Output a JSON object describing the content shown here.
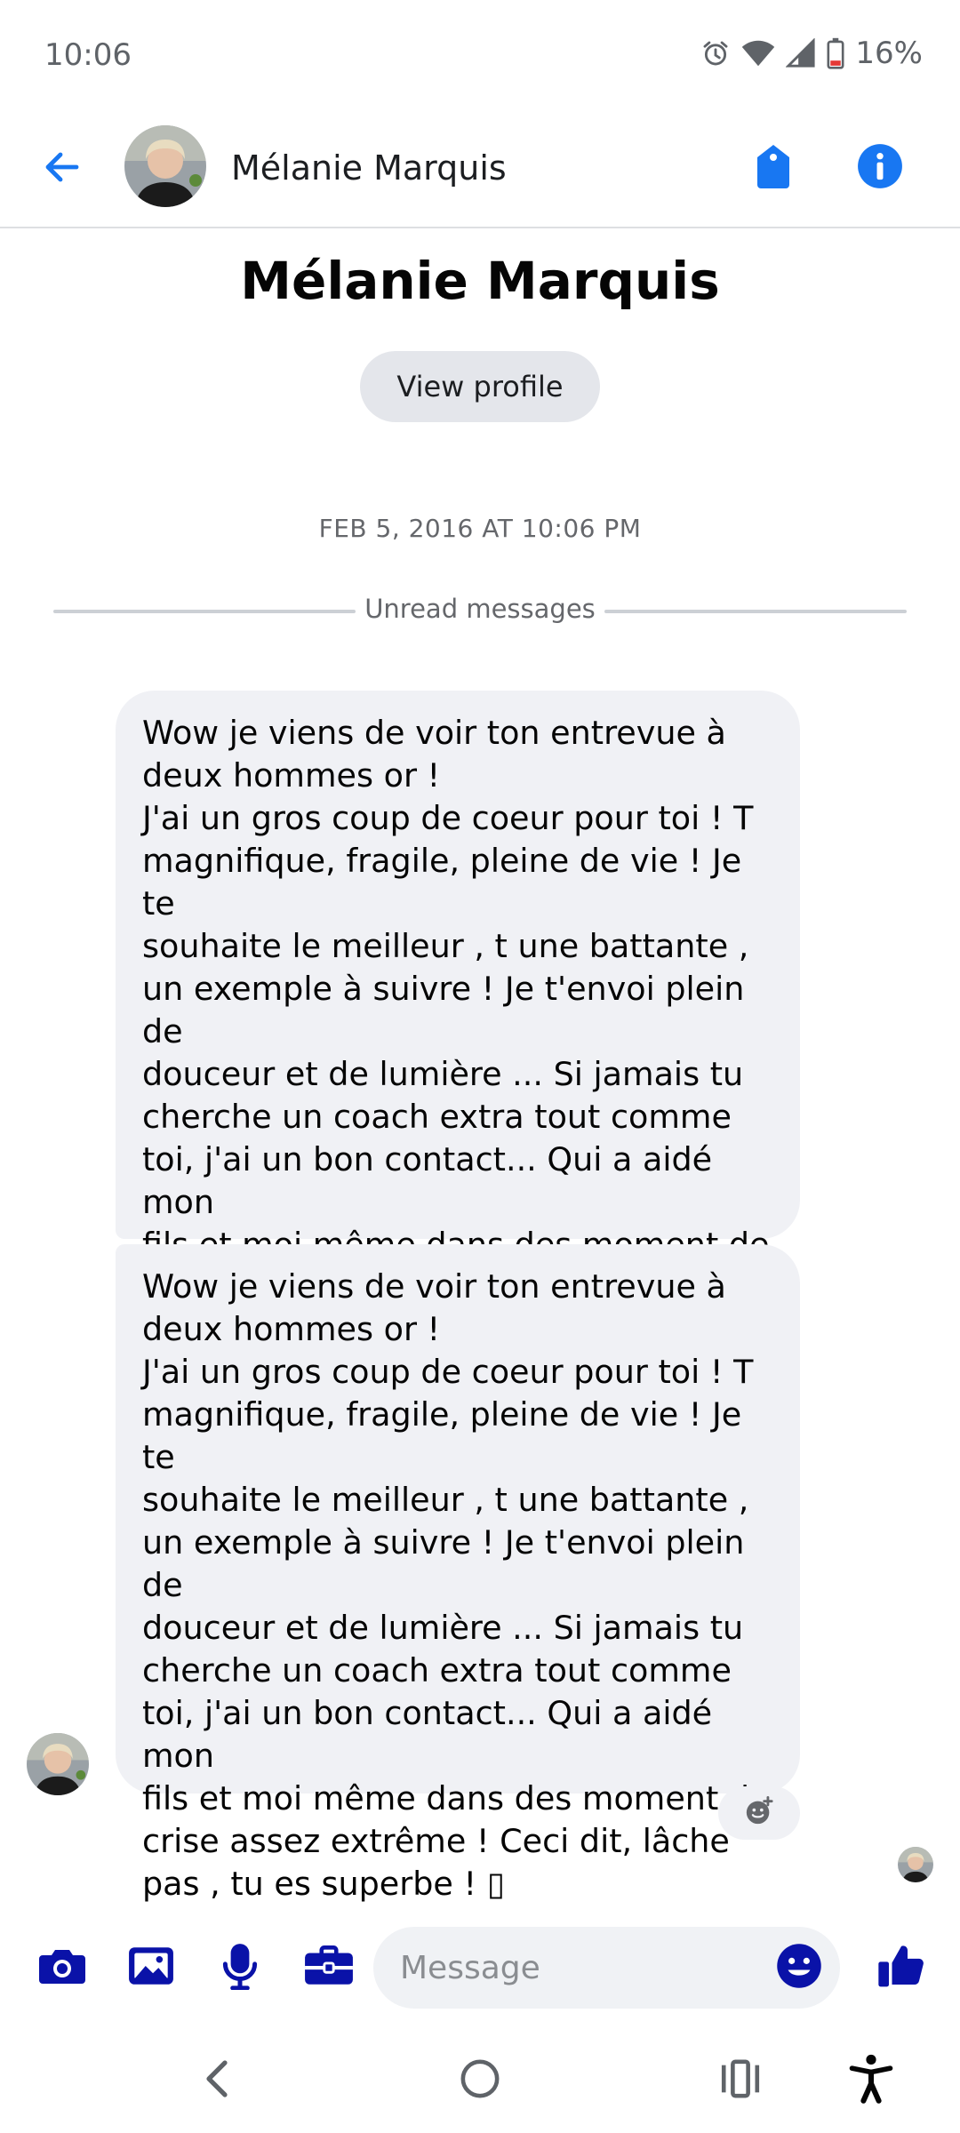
{
  "status_bar": {
    "time": "10:06",
    "battery": "16%"
  },
  "header": {
    "name": "Mélanie Marquis",
    "back_icon": "arrow-left-icon",
    "tag_icon": "tag-icon",
    "info_icon": "info-icon"
  },
  "profile": {
    "name": "Mélanie Marquis",
    "view_profile_label": "View profile"
  },
  "conversation": {
    "timestamp": "FEB 5, 2016 AT 10:06 PM",
    "unread_label": "Unread messages",
    "messages": [
      {
        "text": "Wow je viens de voir ton entrevue à\ndeux hommes or !\nJ'ai un gros coup de coeur pour toi ! T\nmagnifique, fragile, pleine de vie ! Je te\nsouhaite le meilleur , t une battante ,\nun exemple à suivre ! Je t'envoi plein de\ndouceur et de lumière ... Si jamais tu\ncherche un coach extra tout comme\ntoi, j'ai un bon contact... Qui a aidé mon\nfils et moi même dans des moment de\ncrise assez extrême ! Ceci dit, lâche\npas , tu es superbe ! ▯"
      },
      {
        "text": "Wow je viens de voir ton entrevue à\ndeux hommes or !\nJ'ai un gros coup de coeur pour toi ! T\nmagnifique, fragile, pleine de vie ! Je te\nsouhaite le meilleur , t une battante ,\nun exemple à suivre ! Je t'envoi plein de\ndouceur et de lumière ... Si jamais tu\ncherche un coach extra tout comme\ntoi, j'ai un bon contact... Qui a aidé mon\nfils et moi même dans des moment de\ncrise assez extrême ! Ceci dit, lâche\npas , tu es superbe ! ▯"
      }
    ]
  },
  "composer": {
    "placeholder": "Message",
    "icons": [
      "camera-icon",
      "gallery-icon",
      "microphone-icon",
      "briefcase-icon",
      "emoji-icon",
      "thumbs-up-icon"
    ]
  },
  "colors": {
    "accent": "#1877f2",
    "composer_icons": "#0a12a8",
    "bubble": "#f0f1f5"
  }
}
